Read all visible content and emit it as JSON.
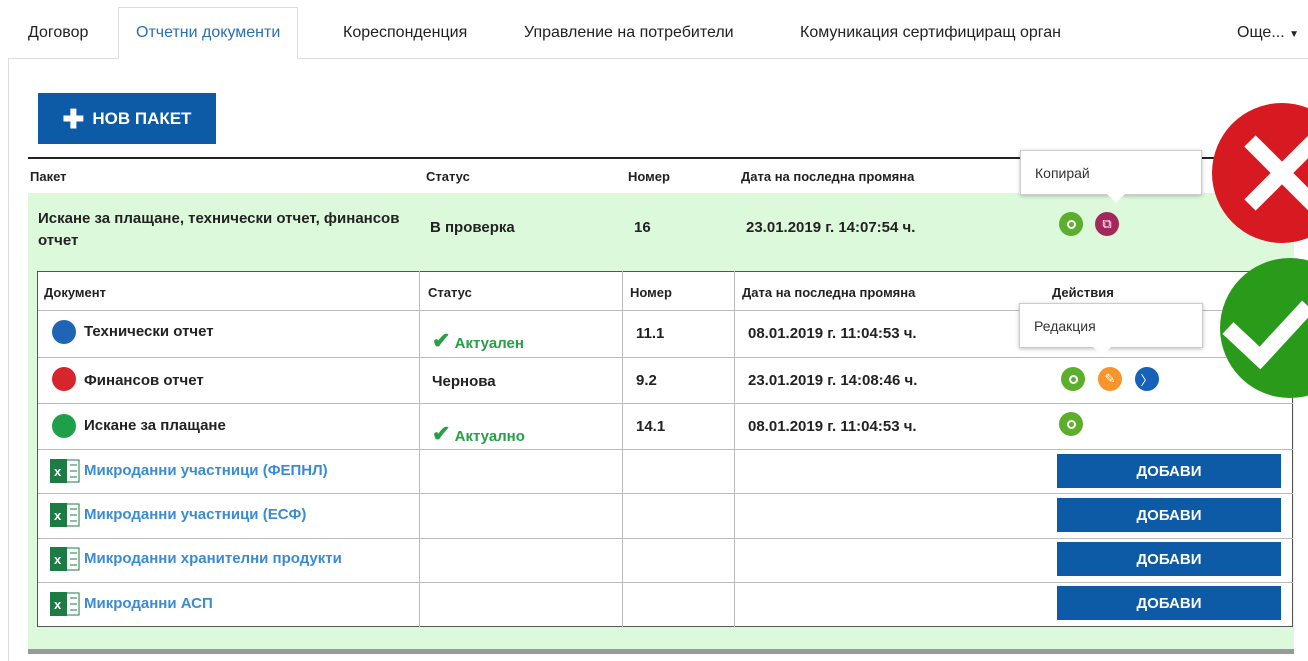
{
  "tabs": [
    "Договор",
    "Отчетни документи",
    "Кореспонденция",
    "Управление на потребители",
    "Комуникация сертифициращ орган",
    "Още..."
  ],
  "new_package_label": "НОВ ПАКЕТ",
  "package_headers": {
    "package": "Пакет",
    "status": "Статус",
    "number": "Номер",
    "date": "Дата на последна промяна"
  },
  "package": {
    "name": "Искане за плащане, технически отчет, финансов отчет",
    "status": "В проверка",
    "number": "16",
    "date": "23.01.2019 г. 14:07:54 ч."
  },
  "tooltips": {
    "copy": "Копирай",
    "edit": "Редакция"
  },
  "doc_headers": {
    "document": "Документ",
    "status": "Статус",
    "number": "Номер",
    "date": "Дата на последна промяна",
    "actions": "Действия"
  },
  "documents": [
    {
      "name": "Технически отчет",
      "status": "Актуален",
      "number": "11.1",
      "date": "08.01.2019 г. 11:04:53 ч.",
      "icon_color": "#1f65b5"
    },
    {
      "name": "Финансов отчет",
      "status": "Чернова",
      "number": "9.2",
      "date": "23.01.2019 г. 14:08:46 ч.",
      "icon_color": "#d7262b"
    },
    {
      "name": "Искане за плащане",
      "status": "Актуално",
      "number": "14.1",
      "date": "08.01.2019 г. 11:04:53 ч.",
      "icon_color": "#1ea04a"
    }
  ],
  "microdata": [
    {
      "name": "Микроданни участници (ФЕПНЛ)",
      "button": "ДОБАВИ"
    },
    {
      "name": "Микроданни участници (ЕСФ)",
      "button": "ДОБАВИ"
    },
    {
      "name": "Микроданни хранителни продукти",
      "button": "ДОБАВИ"
    },
    {
      "name": "Микроданни АСП",
      "button": "ДОБАВИ"
    }
  ],
  "colors": {
    "primary": "#0d5aa7",
    "green_bg": "#dcfadb",
    "eye": "#5dae2d",
    "copy": "#a3285c",
    "edit": "#f5952a",
    "next": "#1861b8",
    "ok": "#25a046"
  }
}
